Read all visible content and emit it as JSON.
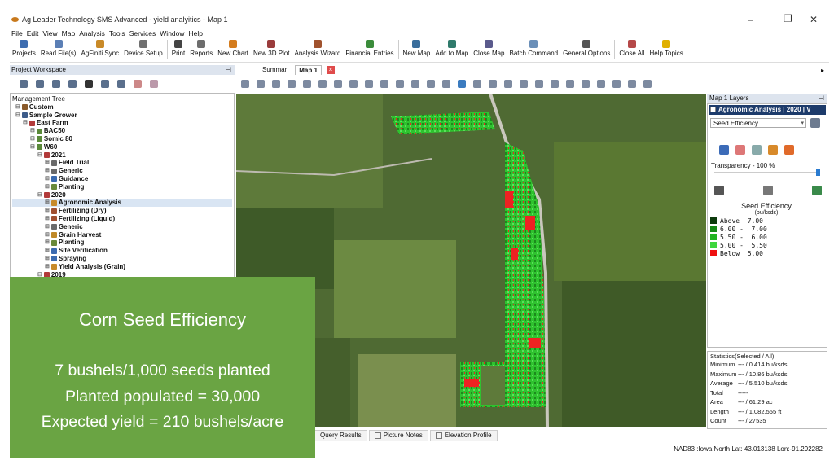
{
  "window": {
    "title": "Ag Leader Technology SMS Advanced - yield analyitics - Map 1"
  },
  "menu": [
    "File",
    "Edit",
    "View",
    "Map",
    "Analysis",
    "Tools",
    "Services",
    "Window",
    "Help"
  ],
  "toolbar": [
    {
      "label": "Projects",
      "icon": "projects-icon",
      "color": "#3e6db0"
    },
    {
      "label": "Read File(s)",
      "icon": "read-files-icon",
      "color": "#5b7fb5"
    },
    {
      "label": "AgFiniti Sync",
      "icon": "sync-icon",
      "color": "#c98a28"
    },
    {
      "label": "Device Setup",
      "icon": "device-icon",
      "color": "#707070"
    },
    {
      "label": "Print",
      "icon": "print-icon",
      "color": "#444444"
    },
    {
      "label": "Reports",
      "icon": "reports-icon",
      "color": "#6d6d6d"
    },
    {
      "label": "New Chart",
      "icon": "chart-icon",
      "color": "#d47c1e"
    },
    {
      "label": "New 3D Plot",
      "icon": "plot-icon",
      "color": "#9a3c3c"
    },
    {
      "label": "Analysis Wizard",
      "icon": "wizard-icon",
      "color": "#a0522d"
    },
    {
      "label": "Financial Entries",
      "icon": "financial-icon",
      "color": "#3b8c3b"
    },
    {
      "label": "New Map",
      "icon": "new-map-icon",
      "color": "#3a6e9c"
    },
    {
      "label": "Add to Map",
      "icon": "add-map-icon",
      "color": "#2f7a6b"
    },
    {
      "label": "Close Map",
      "icon": "close-map-icon",
      "color": "#5a5a8c"
    },
    {
      "label": "Batch Command",
      "icon": "batch-icon",
      "color": "#6a8fb8"
    },
    {
      "label": "General Options",
      "icon": "options-icon",
      "color": "#555555"
    },
    {
      "label": "Close All",
      "icon": "close-all-icon",
      "color": "#b54848"
    },
    {
      "label": "Help Topics",
      "icon": "help-icon",
      "color": "#e0b000"
    }
  ],
  "workspace": {
    "title": "Project Workspace",
    "tree_label": "Management Tree",
    "nodes": [
      {
        "label": "Custom",
        "depth": 0,
        "bold": true,
        "color": "#8a5a2a"
      },
      {
        "label": "Sample Grower",
        "depth": 0,
        "bold": true,
        "color": "#3d5c8a"
      },
      {
        "label": "East Farm",
        "depth": 1,
        "bold": true,
        "color": "#b23a3a"
      },
      {
        "label": "BAC50",
        "depth": 2,
        "bold": true,
        "color": "#5b8a3a"
      },
      {
        "label": "Somic 80",
        "depth": 2,
        "bold": true,
        "color": "#5b8a3a"
      },
      {
        "label": "W60",
        "depth": 2,
        "bold": true,
        "color": "#5b8a3a"
      },
      {
        "label": "2021",
        "depth": 3,
        "bold": true,
        "color": "#b23a3a"
      },
      {
        "label": "Field Trial",
        "depth": 4,
        "bold": true,
        "color": "#6a6a6a"
      },
      {
        "label": "Generic",
        "depth": 4,
        "bold": true,
        "color": "#6a6a6a"
      },
      {
        "label": "Guidance",
        "depth": 4,
        "bold": true,
        "color": "#3b6bb0"
      },
      {
        "label": "Planting",
        "depth": 4,
        "bold": true,
        "color": "#6a8a3a"
      },
      {
        "label": "2020",
        "depth": 3,
        "bold": true,
        "color": "#b23a3a"
      },
      {
        "label": "Agronomic Analysis",
        "depth": 4,
        "bold": true,
        "color": "#c78a2a",
        "selected": true
      },
      {
        "label": "Fertilizing (Dry)",
        "depth": 4,
        "bold": true,
        "color": "#a05030"
      },
      {
        "label": "Fertilizing (Liquid)",
        "depth": 4,
        "bold": true,
        "color": "#a05030"
      },
      {
        "label": "Generic",
        "depth": 4,
        "bold": true,
        "color": "#6a6a6a"
      },
      {
        "label": "Grain Harvest",
        "depth": 4,
        "bold": true,
        "color": "#c08a2a"
      },
      {
        "label": "Planting",
        "depth": 4,
        "bold": true,
        "color": "#6a8a3a"
      },
      {
        "label": "Site Verification",
        "depth": 4,
        "bold": true,
        "color": "#3b6bb0"
      },
      {
        "label": "Spraying",
        "depth": 4,
        "bold": true,
        "color": "#3b6bb0"
      },
      {
        "label": "Yield Analysis (Grain)",
        "depth": 4,
        "bold": true,
        "color": "#c78a2a"
      },
      {
        "label": "2019",
        "depth": 3,
        "bold": true,
        "color": "#b23a3a"
      }
    ]
  },
  "tabs": {
    "summary": "Summar",
    "map": "Map 1",
    "close": "×"
  },
  "layers": {
    "header": "Map 1 Layers",
    "layer_title": "Agronomic Analysis | 2020 | V",
    "attribute": "Seed Efficiency",
    "transparency": "Transparency - 100 %",
    "transparency_value": 100,
    "legend_title": "Seed Efficiency",
    "legend_unit": "(bu/ksds)",
    "legend": [
      {
        "label": "Above  7.00",
        "color": "#0d3b0d"
      },
      {
        "label": "6.00 -  7.00",
        "color": "#168a16"
      },
      {
        "label": "5.50 -  6.00",
        "color": "#21b321"
      },
      {
        "label": "5.00 -  5.50",
        "color": "#3ed63e"
      },
      {
        "label": "Below  5.00",
        "color": "#ee1111"
      }
    ]
  },
  "stats": {
    "header": "Statistics(Selected / All)",
    "rows": [
      {
        "k": "Minimum",
        "v": "--- / 0.414 bu/ksds"
      },
      {
        "k": "Maximum",
        "v": "--- / 10.86 bu/ksds"
      },
      {
        "k": "Average",
        "v": "--- / 5.510 bu/ksds"
      },
      {
        "k": "Total",
        "v": "-----"
      },
      {
        "k": "Area",
        "v": "--- / 61.29 ac"
      },
      {
        "k": "Length",
        "v": "--- / 1,082,555 ft"
      },
      {
        "k": "Count",
        "v": "--- / 27535"
      }
    ]
  },
  "bottom_tabs": [
    "Query Results",
    "Picture Notes",
    "Elevation Profile"
  ],
  "status": {
    "coords": "NAD83 :Iowa North   Lat: 43.013138   Lon:-91.292282"
  },
  "overlay": {
    "title": "Corn Seed Efficiency",
    "lines": [
      "7 bushels/1,000 seeds planted",
      "Planted populated = 30,000",
      "Expected yield = 210 bushels/acre"
    ],
    "color": "#6aa443"
  }
}
